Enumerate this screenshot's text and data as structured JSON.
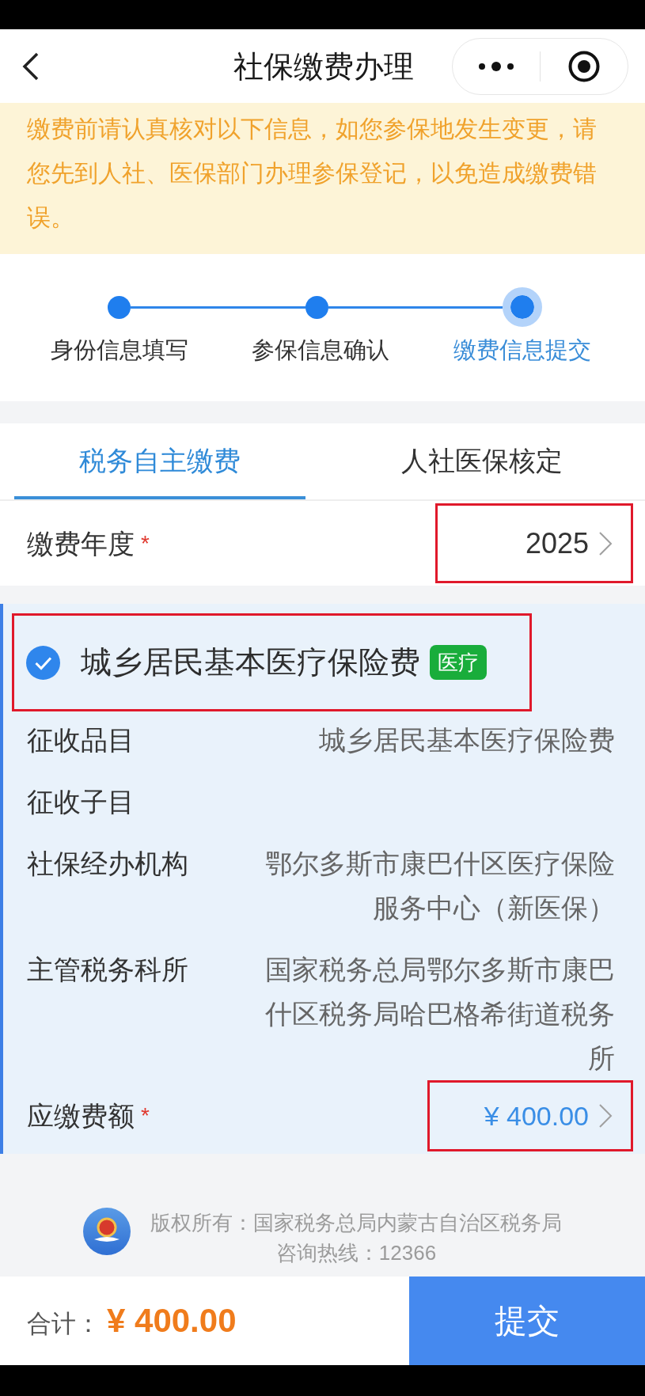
{
  "nav_bar": {
    "title": "社保缴费办理"
  },
  "notice": "缴费前请认真核对以下信息，如您参保地发生变更，请您先到人社、医保部门办理参保登记，以免造成缴费错误。",
  "steps": [
    {
      "label": "身份信息填写",
      "selected": false
    },
    {
      "label": "参保信息确认",
      "selected": false
    },
    {
      "label": "缴费信息提交",
      "selected": true
    }
  ],
  "tabs": [
    {
      "label": "税务自主缴费",
      "selected": true
    },
    {
      "label": "人社医保核定",
      "selected": false
    }
  ],
  "year_field": {
    "label": "缴费年度",
    "required_mark": "*",
    "value": "2025",
    "annotated": true
  },
  "insurance_item": {
    "checked": true,
    "title": "城乡居民基本医疗保险费",
    "tag": "医疗",
    "annotated": true,
    "details": [
      {
        "label": "征收品目",
        "value": "城乡居民基本医疗保险费"
      },
      {
        "label": "征收子目"
      },
      {
        "label": "社保经办机构",
        "value": "鄂尔多斯市康巴什区医疗保险服务中心（新医保）"
      },
      {
        "label": "主管税务科所",
        "value": "国家税务总局鄂尔多斯市康巴什区税务局哈巴格希街道税务所"
      }
    ],
    "amount": {
      "label": "应缴费额",
      "required_mark": "*",
      "value": "¥ 400.00",
      "annotated": true
    }
  },
  "footer": {
    "copyright": "版权所有：国家税务总局内蒙古自治区税务局",
    "hotline": "咨询热线：12366"
  },
  "bottom_bar": {
    "total_label": "合计：",
    "total": "¥ 400.00",
    "submit": "提交"
  }
}
